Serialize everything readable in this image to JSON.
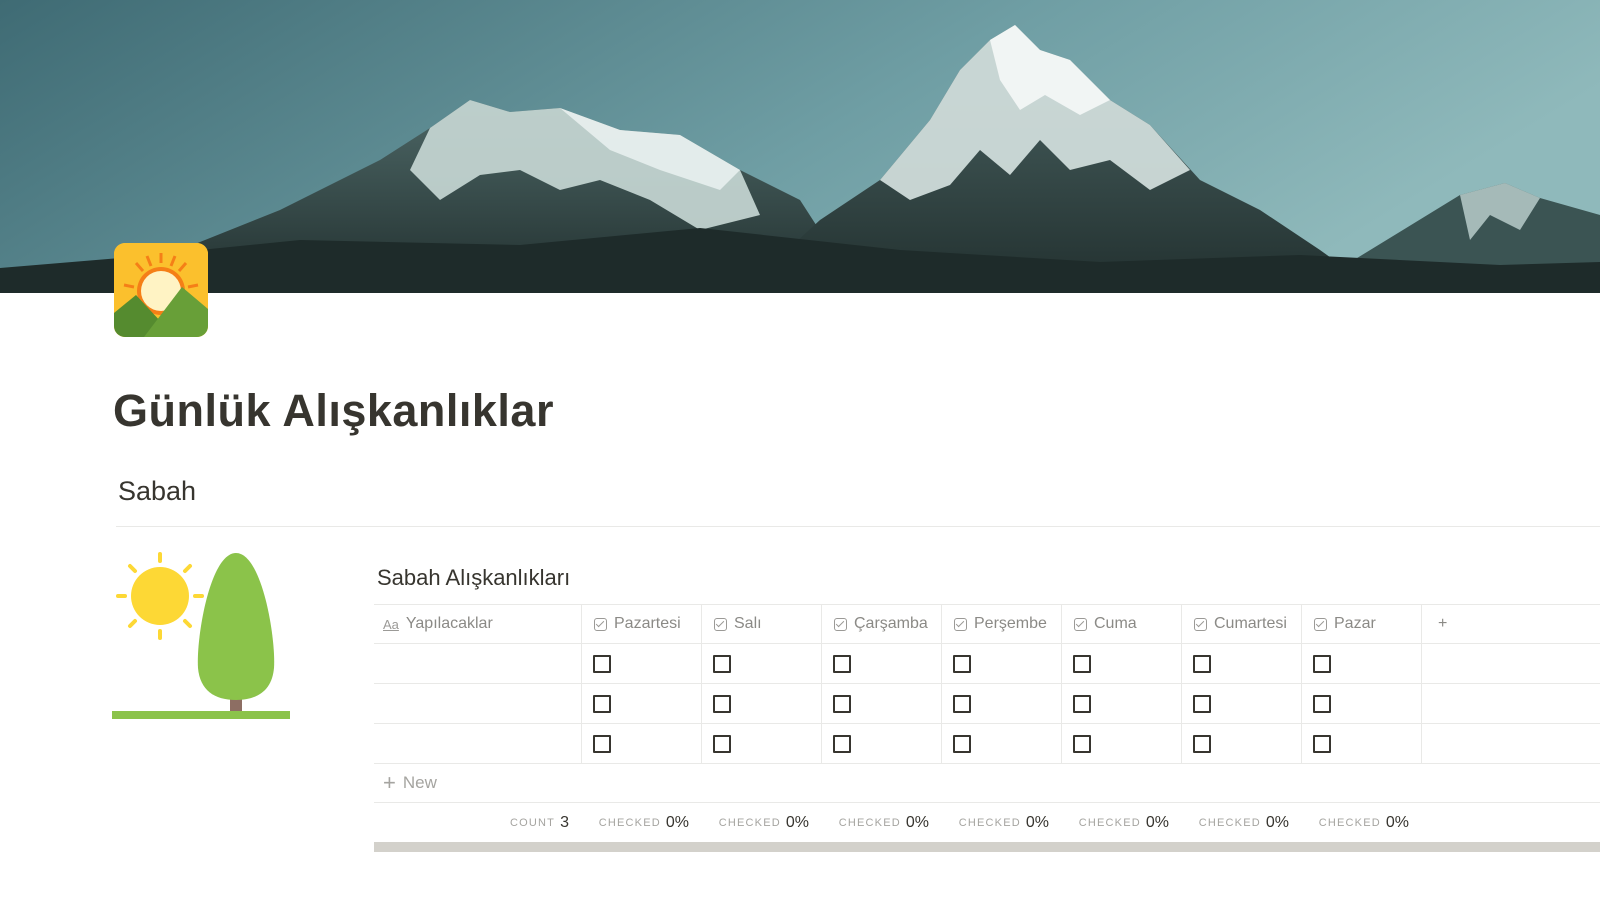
{
  "page": {
    "title": "Günlük Alışkanlıklar",
    "icon": "sunrise-mountain-icon",
    "cover": "mountain-cover-image"
  },
  "section": {
    "heading": "Sabah",
    "illustration": "sun-and-tree-illustration"
  },
  "database": {
    "title": "Sabah Alışkanlıkları",
    "title_column": {
      "label": "Yapılacaklar",
      "icon": "Aa"
    },
    "columns": [
      {
        "label": "Pazartesi",
        "icon": "checkbox-property-icon"
      },
      {
        "label": "Salı",
        "icon": "checkbox-property-icon"
      },
      {
        "label": "Çarşamba",
        "icon": "checkbox-property-icon"
      },
      {
        "label": "Perşembe",
        "icon": "checkbox-property-icon"
      },
      {
        "label": "Cuma",
        "icon": "checkbox-property-icon"
      },
      {
        "label": "Cumartesi",
        "icon": "checkbox-property-icon"
      },
      {
        "label": "Pazar",
        "icon": "checkbox-property-icon"
      }
    ],
    "add_column_label": "+",
    "rows": [
      {
        "name": "",
        "checks": [
          false,
          false,
          false,
          false,
          false,
          false,
          false
        ]
      },
      {
        "name": "",
        "checks": [
          false,
          false,
          false,
          false,
          false,
          false,
          false
        ]
      },
      {
        "name": "",
        "checks": [
          false,
          false,
          false,
          false,
          false,
          false,
          false
        ]
      }
    ],
    "new_row": {
      "plus": "+",
      "label": "New"
    },
    "calculations": {
      "count": {
        "label": "COUNT",
        "value": "3"
      },
      "checked": [
        {
          "label": "CHECKED",
          "value": "0%"
        },
        {
          "label": "CHECKED",
          "value": "0%"
        },
        {
          "label": "CHECKED",
          "value": "0%"
        },
        {
          "label": "CHECKED",
          "value": "0%"
        },
        {
          "label": "CHECKED",
          "value": "0%"
        },
        {
          "label": "CHECKED",
          "value": "0%"
        },
        {
          "label": "CHECKED",
          "value": "0%"
        }
      ]
    }
  },
  "colors": {
    "text": "#37352f",
    "muted": "#8b8a86",
    "border": "#e9e9e7",
    "cover_sky": "#6f9ea4",
    "sun": "#fdd835",
    "tree": "#8bc34a"
  }
}
